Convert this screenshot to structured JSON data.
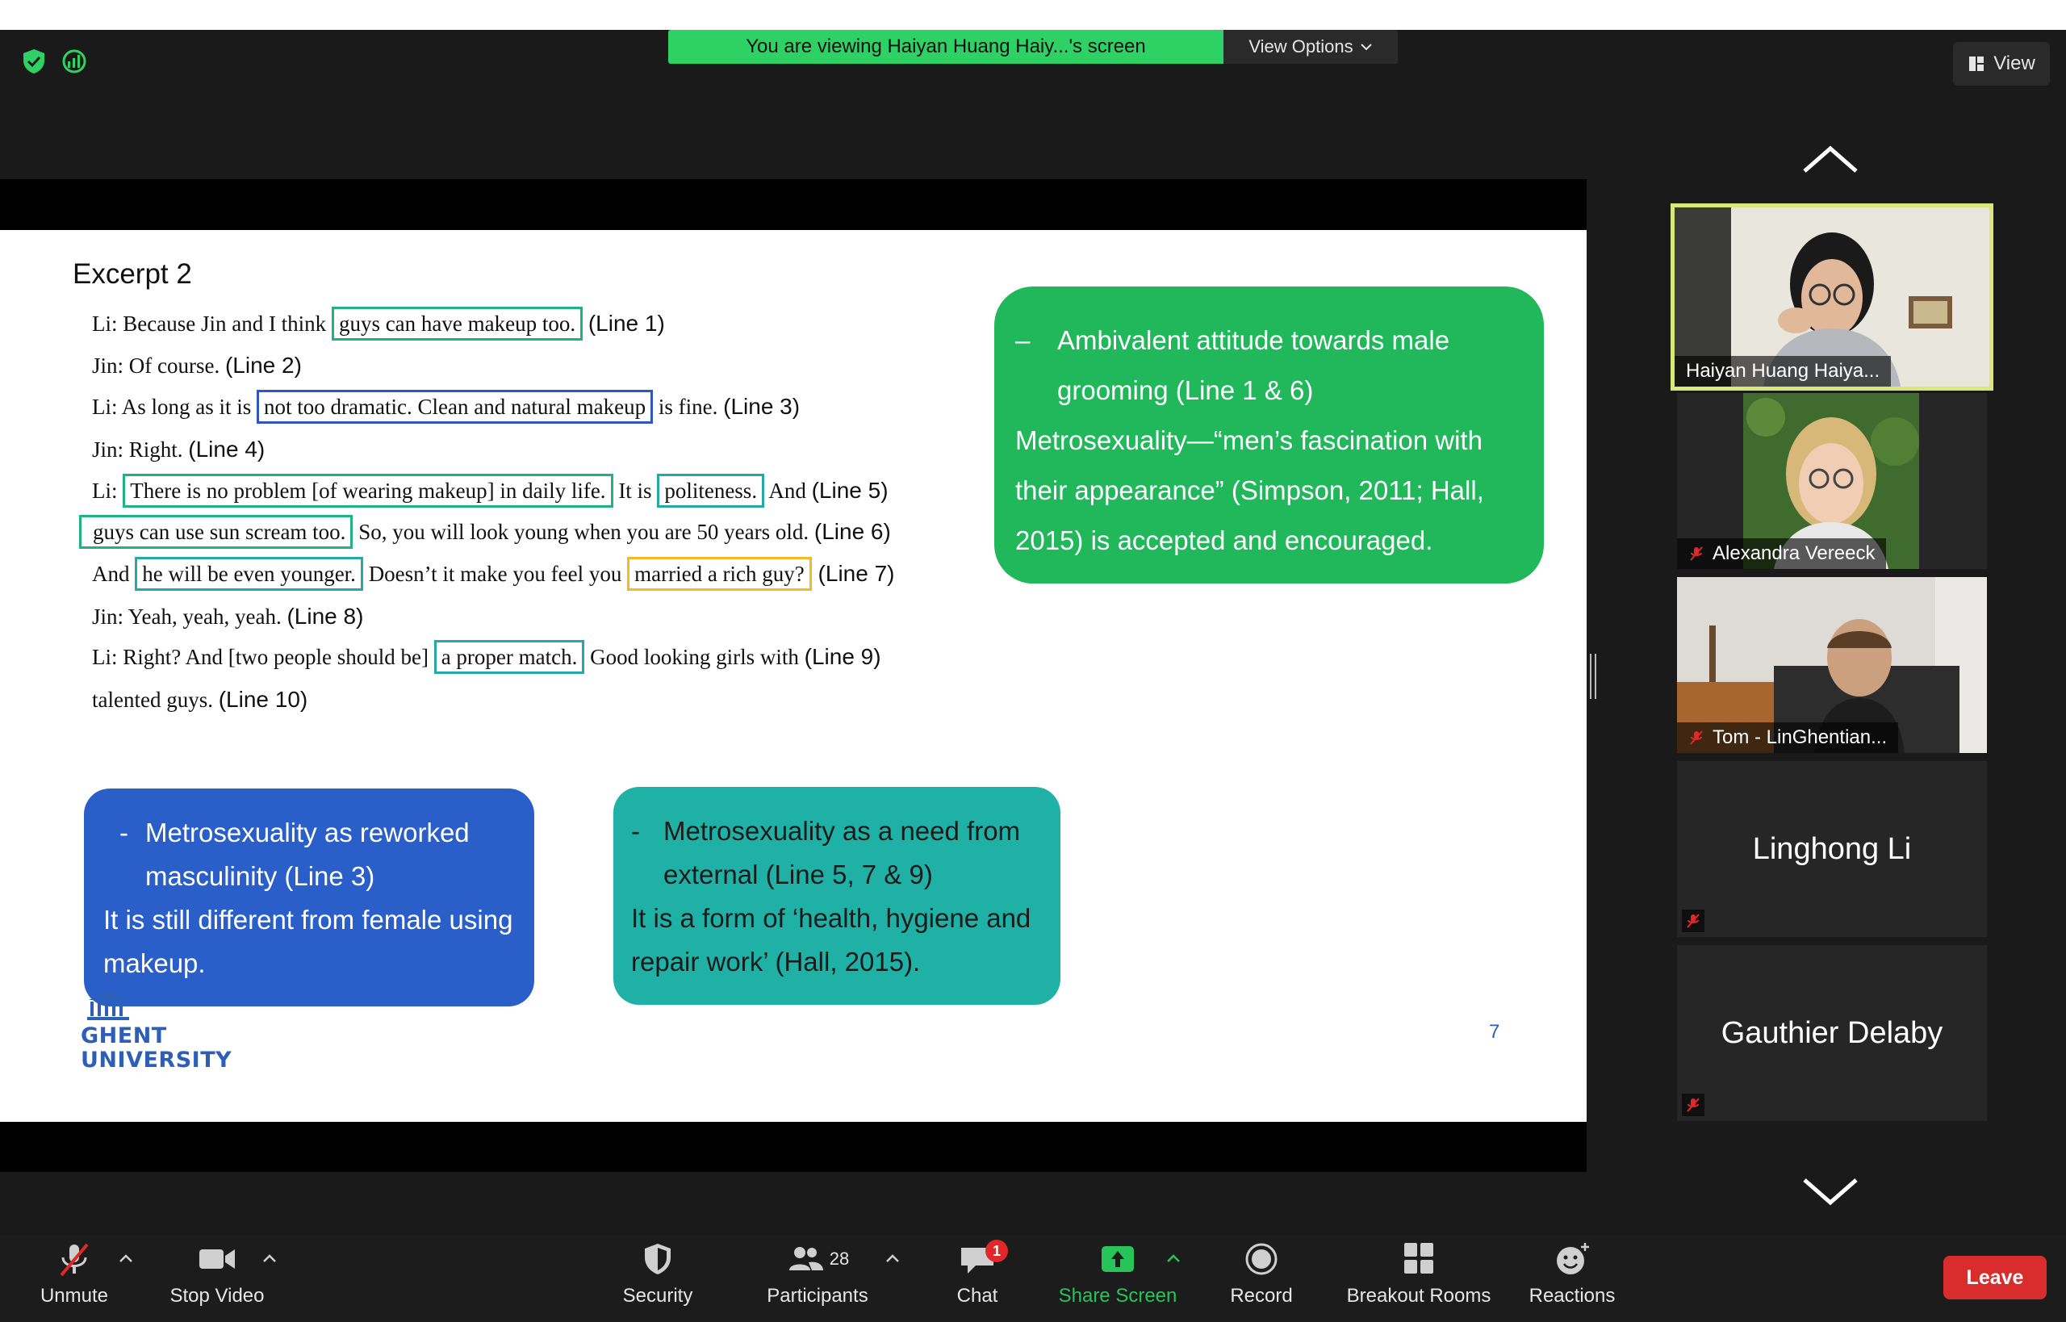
{
  "banner": {
    "viewing_text": "You are viewing Haiyan Huang Haiy...'s screen",
    "view_options_label": "View Options"
  },
  "view_button": {
    "label": "View"
  },
  "slide": {
    "title": "Excerpt 2",
    "lines": {
      "l1": {
        "a": "Li: Because Jin and I think ",
        "h1": "guys can have makeup too.",
        "num": "(Line 1)"
      },
      "l2": {
        "a": "Jin: Of course.  ",
        "num": "(Line 2)"
      },
      "l3": {
        "a": "Li: As long as it is ",
        "h1": "not too dramatic. Clean and natural makeup",
        "b": " is fine.  ",
        "num": "(Line 3)"
      },
      "l4": {
        "a": "Jin: Right.  ",
        "num": "(Line 4)"
      },
      "l5": {
        "a": "Li: ",
        "h1": "There is no problem [of wearing makeup] in daily life.",
        "b": " It is ",
        "h2": "politeness.",
        "c": " And  ",
        "num": "(Line 5)"
      },
      "l6": {
        "h1": "guys can use sun scream too.",
        "a": " So, you will look young when you are 50 years old. ",
        "num": "(Line 6)"
      },
      "l7": {
        "a": "And ",
        "h1": "he will be even younger.",
        "b": " Doesn’t it make you feel you ",
        "h2": "married a rich guy?",
        "num": " (Line 7)"
      },
      "l8": {
        "a": "Jin: Yeah, yeah, yeah.  ",
        "num": "(Line 8)"
      },
      "l9": {
        "a": "Li: Right? And [two people should be] ",
        "h1": "a proper match.",
        "b": " Good looking girls with  ",
        "num": "(Line 9)"
      },
      "l10": {
        "a": "talented guys. ",
        "num": "(Line 10)"
      }
    },
    "callout_green": {
      "dash": "–",
      "bullet": "Ambivalent attitude towards male grooming (Line 1 & 6)",
      "body": "Metrosexuality—“men’s fascination with their appearance” (Simpson, 2011; Hall, 2015) is accepted and encouraged."
    },
    "callout_blue": {
      "dash": "-",
      "bullet": "Metrosexuality as reworked masculinity (Line 3)",
      "body": "It is still different from female using makeup."
    },
    "callout_teal": {
      "dash": "-",
      "bullet": "Metrosexuality as a need from external (Line 5, 7 & 9)",
      "body": "It is a form of ‘health, hygiene and repair work’  (Hall, 2015)."
    },
    "logo_line1": "GHENT",
    "logo_line2": "UNIVERSITY",
    "page_number": "7"
  },
  "participants_panel": [
    {
      "name": "Haiyan Huang Haiya...",
      "video": true,
      "muted": false,
      "active": true
    },
    {
      "name": "Alexandra Vereeck",
      "video": true,
      "muted": true
    },
    {
      "name": "Tom - LinGhentian...",
      "video": true,
      "muted": true
    },
    {
      "name": "Linghong Li",
      "video": false,
      "muted": true
    },
    {
      "name": "Gauthier Delaby",
      "video": false,
      "muted": true
    }
  ],
  "toolbar": {
    "unmute": "Unmute",
    "stop_video": "Stop Video",
    "security": "Security",
    "participants": "Participants",
    "participants_count": "28",
    "chat": "Chat",
    "chat_badge": "1",
    "share_screen": "Share Screen",
    "record": "Record",
    "breakout_rooms": "Breakout Rooms",
    "reactions": "Reactions",
    "leave": "Leave"
  },
  "colors": {
    "share_green": "#2ed164",
    "callout_green": "#21b75b",
    "callout_blue": "#2a5ec9",
    "callout_teal": "#1fb0a6",
    "active_speaker_border": "#d9e87a",
    "leave_red": "#d92d2d"
  },
  "icons": {
    "security": "shield-check-icon",
    "network": "network-status-icon",
    "view": "grid-view-icon",
    "mic_off": "mic-off-icon",
    "video": "video-camera-icon",
    "participants": "people-icon",
    "chat": "chat-bubble-icon",
    "share": "share-screen-icon",
    "record": "record-icon",
    "breakout": "breakout-grid-icon",
    "reactions": "smiley-icon"
  }
}
